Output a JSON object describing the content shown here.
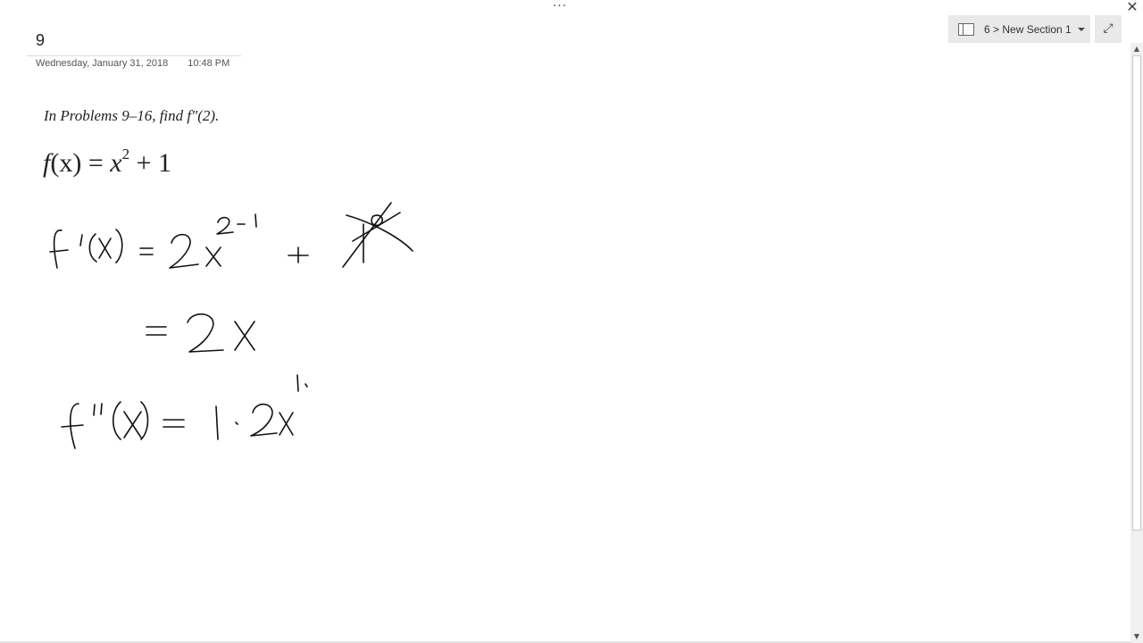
{
  "window": {
    "more_glyph": "···",
    "close_glyph": "✕"
  },
  "section_picker": {
    "label": "6 > New Section 1",
    "icon": "notebook-icon"
  },
  "expand": {
    "glyph": "⤢",
    "icon": "expand-icon"
  },
  "page": {
    "title": "9",
    "date": "Wednesday, January 31, 2018",
    "time": "10:48 PM"
  },
  "content": {
    "problem_statement": "In Problems 9–16, find f″(2).",
    "equation": {
      "lhs": "f",
      "arg": "(x)",
      "eq": " = ",
      "var": "x",
      "exp": "2",
      "rest": " + 1"
    }
  },
  "ink": {
    "line1": "f ′(x) = 2x^(2-1) + 1 (crossed out)",
    "line2": "= 2x",
    "line3": "f ″(x) = 1·2x^1"
  },
  "scrollbar": {
    "up_glyph": "▲",
    "down_glyph": "▼"
  }
}
